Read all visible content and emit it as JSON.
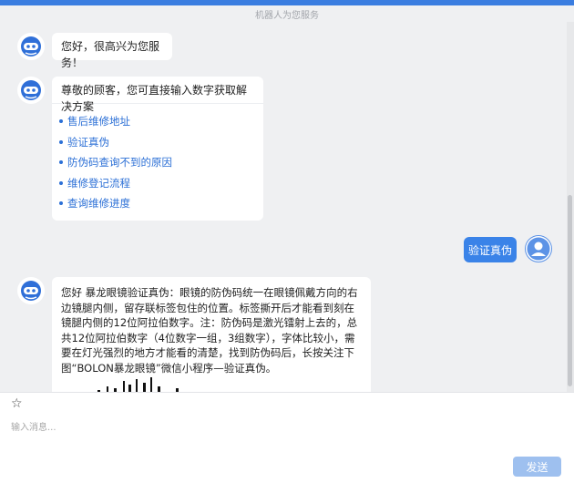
{
  "banner": "机器人为您服务",
  "messages": {
    "greeting": "您好，很高兴为您服务！",
    "menu_header": "尊敬的顾客，您可直接输入数字获取解决方案",
    "menu_items": [
      "售后维修地址",
      "验证真伪",
      "防伪码查询不到的原因",
      "维修登记流程",
      "查询维修进度"
    ],
    "user_message": "验证真伪",
    "answer": "您好 暴龙眼镜验证真伪：眼镜的防伪码统一在眼镜佩戴方向的右边镜腿内侧，留存联标签包住的位置。标签撕开后才能看到刻在镜腿内侧的12位阿拉伯数字。注：防伪码是激光镭射上去的，总共12位阿拉伯数字（4位数字一组，3组数字），字体比较小，需要在灯光强烈的地方才能看的清楚，找到防伪码后，长按关注下图“BOLON暴龙眼镜”微信小程序—验证真伪。"
  },
  "composer": {
    "placeholder": "输入消息...",
    "send_label": "发送"
  },
  "icons": {
    "favorite": "star-icon",
    "bot": "bot-avatar-icon",
    "user": "user-avatar-icon"
  },
  "colors": {
    "accent": "#3a7de0",
    "link": "#2b6fd6",
    "send_disabled": "#9ec0ef"
  }
}
